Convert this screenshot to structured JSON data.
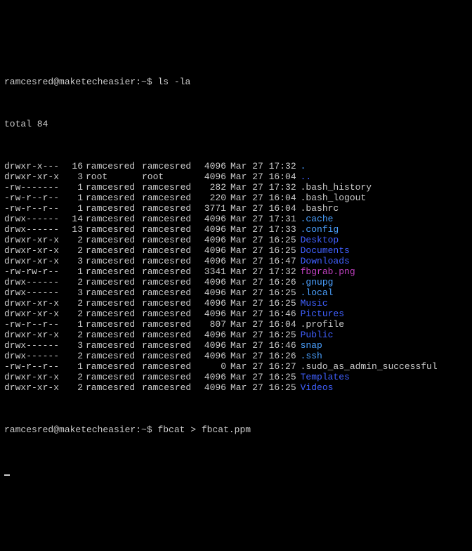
{
  "prompt1": {
    "userhost": "ramcesred@maketecheasier",
    "path": ":~$ ",
    "cmd": "ls -la"
  },
  "total": "total 84",
  "rows": [
    {
      "perm": "drwxr-x---",
      "links": "16",
      "owner": "ramcesred",
      "group": "ramcesred",
      "size": "4096",
      "date": "Mar 27 17:32",
      "name": ".",
      "color": "c-cyan"
    },
    {
      "perm": "drwxr-xr-x",
      "links": "3",
      "owner": "root",
      "group": "root",
      "size": "4096",
      "date": "Mar 27 16:04",
      "name": "..",
      "color": "c-blue"
    },
    {
      "perm": "-rw-------",
      "links": "1",
      "owner": "ramcesred",
      "group": "ramcesred",
      "size": "282",
      "date": "Mar 27 17:32",
      "name": ".bash_history",
      "color": "c-default"
    },
    {
      "perm": "-rw-r--r--",
      "links": "1",
      "owner": "ramcesred",
      "group": "ramcesred",
      "size": "220",
      "date": "Mar 27 16:04",
      "name": ".bash_logout",
      "color": "c-default"
    },
    {
      "perm": "-rw-r--r--",
      "links": "1",
      "owner": "ramcesred",
      "group": "ramcesred",
      "size": "3771",
      "date": "Mar 27 16:04",
      "name": ".bashrc",
      "color": "c-default"
    },
    {
      "perm": "drwx------",
      "links": "14",
      "owner": "ramcesred",
      "group": "ramcesred",
      "size": "4096",
      "date": "Mar 27 17:31",
      "name": ".cache",
      "color": "c-cyan"
    },
    {
      "perm": "drwx------",
      "links": "13",
      "owner": "ramcesred",
      "group": "ramcesred",
      "size": "4096",
      "date": "Mar 27 17:33",
      "name": ".config",
      "color": "c-cyan"
    },
    {
      "perm": "drwxr-xr-x",
      "links": "2",
      "owner": "ramcesred",
      "group": "ramcesred",
      "size": "4096",
      "date": "Mar 27 16:25",
      "name": "Desktop",
      "color": "c-blue"
    },
    {
      "perm": "drwxr-xr-x",
      "links": "2",
      "owner": "ramcesred",
      "group": "ramcesred",
      "size": "4096",
      "date": "Mar 27 16:25",
      "name": "Documents",
      "color": "c-blue"
    },
    {
      "perm": "drwxr-xr-x",
      "links": "3",
      "owner": "ramcesred",
      "group": "ramcesred",
      "size": "4096",
      "date": "Mar 27 16:47",
      "name": "Downloads",
      "color": "c-blue"
    },
    {
      "perm": "-rw-rw-r--",
      "links": "1",
      "owner": "ramcesred",
      "group": "ramcesred",
      "size": "3341",
      "date": "Mar 27 17:32",
      "name": "fbgrab.png",
      "color": "c-magenta"
    },
    {
      "perm": "drwx------",
      "links": "2",
      "owner": "ramcesred",
      "group": "ramcesred",
      "size": "4096",
      "date": "Mar 27 16:26",
      "name": ".gnupg",
      "color": "c-cyan"
    },
    {
      "perm": "drwx------",
      "links": "3",
      "owner": "ramcesred",
      "group": "ramcesred",
      "size": "4096",
      "date": "Mar 27 16:25",
      "name": ".local",
      "color": "c-cyan"
    },
    {
      "perm": "drwxr-xr-x",
      "links": "2",
      "owner": "ramcesred",
      "group": "ramcesred",
      "size": "4096",
      "date": "Mar 27 16:25",
      "name": "Music",
      "color": "c-blue"
    },
    {
      "perm": "drwxr-xr-x",
      "links": "2",
      "owner": "ramcesred",
      "group": "ramcesred",
      "size": "4096",
      "date": "Mar 27 16:46",
      "name": "Pictures",
      "color": "c-blue"
    },
    {
      "perm": "-rw-r--r--",
      "links": "1",
      "owner": "ramcesred",
      "group": "ramcesred",
      "size": "807",
      "date": "Mar 27 16:04",
      "name": ".profile",
      "color": "c-default"
    },
    {
      "perm": "drwxr-xr-x",
      "links": "2",
      "owner": "ramcesred",
      "group": "ramcesred",
      "size": "4096",
      "date": "Mar 27 16:25",
      "name": "Public",
      "color": "c-blue"
    },
    {
      "perm": "drwx------",
      "links": "3",
      "owner": "ramcesred",
      "group": "ramcesred",
      "size": "4096",
      "date": "Mar 27 16:46",
      "name": "snap",
      "color": "c-cyan"
    },
    {
      "perm": "drwx------",
      "links": "2",
      "owner": "ramcesred",
      "group": "ramcesred",
      "size": "4096",
      "date": "Mar 27 16:26",
      "name": ".ssh",
      "color": "c-cyan"
    },
    {
      "perm": "-rw-r--r--",
      "links": "1",
      "owner": "ramcesred",
      "group": "ramcesred",
      "size": "0",
      "date": "Mar 27 16:27",
      "name": ".sudo_as_admin_successful",
      "color": "c-default"
    },
    {
      "perm": "drwxr-xr-x",
      "links": "2",
      "owner": "ramcesred",
      "group": "ramcesred",
      "size": "4096",
      "date": "Mar 27 16:25",
      "name": "Templates",
      "color": "c-blue"
    },
    {
      "perm": "drwxr-xr-x",
      "links": "2",
      "owner": "ramcesred",
      "group": "ramcesred",
      "size": "4096",
      "date": "Mar 27 16:25",
      "name": "Videos",
      "color": "c-blue"
    }
  ],
  "prompt2": {
    "userhost": "ramcesred@maketecheasier",
    "path": ":~$ ",
    "cmd": "fbcat > fbcat.ppm"
  }
}
